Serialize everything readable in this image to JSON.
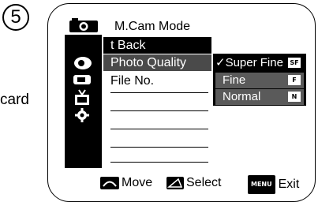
{
  "step_number": "5",
  "side_label": "card",
  "menu": {
    "title": "M.Cam Mode",
    "back": "Back",
    "back_glyph": "t",
    "items": [
      "Photo Quality",
      "File No."
    ]
  },
  "submenu": {
    "check": "✓",
    "options": [
      {
        "label": "Super Fine",
        "badge": "SF",
        "selected": true
      },
      {
        "label": "Fine",
        "badge": "F",
        "selected": false
      },
      {
        "label": "Normal",
        "badge": "N",
        "selected": false
      }
    ]
  },
  "footer": {
    "move": "Move",
    "select": "Select",
    "menu_key": "MENU",
    "exit": "Exit"
  },
  "icons": [
    "camera-icon",
    "photo-settings-icon",
    "memory-card-icon",
    "tape-icon",
    "gear-icon",
    "move-key-icon",
    "select-key-icon"
  ]
}
